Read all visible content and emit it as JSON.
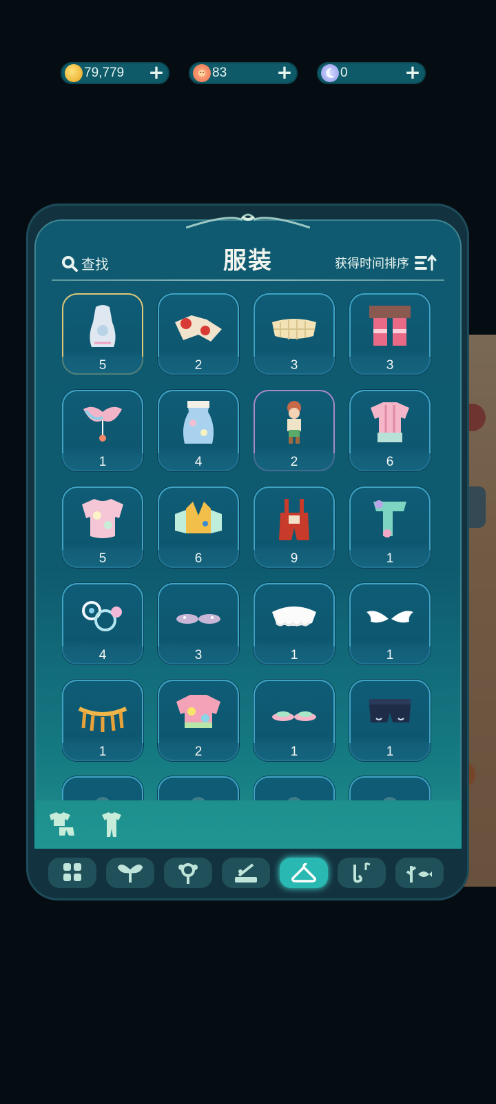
{
  "currencies": [
    {
      "name": "coin",
      "value": "79,779",
      "color": "#f4c23a"
    },
    {
      "name": "flower-token",
      "value": "83",
      "color": "#f3845c"
    },
    {
      "name": "moon-token",
      "value": "0",
      "color": "#9aa7f2"
    }
  ],
  "panel": {
    "title": "服装",
    "search_label": "查找",
    "sort_label": "获得时间排序"
  },
  "items": [
    {
      "icon": "lace-dress-icon",
      "count": "5",
      "rarity": "gold"
    },
    {
      "icon": "red-heart-sleeves-icon",
      "count": "2",
      "rarity": "normal"
    },
    {
      "icon": "waffle-skirt-icon",
      "count": "3",
      "rarity": "normal"
    },
    {
      "icon": "pink-stockings-icon",
      "count": "3",
      "rarity": "normal"
    },
    {
      "icon": "rainbow-collar-icon",
      "count": "1",
      "rarity": "normal"
    },
    {
      "icon": "blue-floral-dress-icon",
      "count": "4",
      "rarity": "normal"
    },
    {
      "icon": "character-outfit-icon",
      "count": "2",
      "rarity": "purple"
    },
    {
      "icon": "pink-shirt-shorts-icon",
      "count": "6",
      "rarity": "normal"
    },
    {
      "icon": "pink-floral-top-icon",
      "count": "5",
      "rarity": "normal"
    },
    {
      "icon": "yellow-overall-top-icon",
      "count": "6",
      "rarity": "normal"
    },
    {
      "icon": "red-overalls-icon",
      "count": "9",
      "rarity": "normal"
    },
    {
      "icon": "mint-leg-warmers-icon",
      "count": "1",
      "rarity": "normal"
    },
    {
      "icon": "flower-wheel-accessory-icon",
      "count": "4",
      "rarity": "normal"
    },
    {
      "icon": "sparkly-shoes-icon",
      "count": "3",
      "rarity": "normal"
    },
    {
      "icon": "lace-collar-icon",
      "count": "1",
      "rarity": "normal"
    },
    {
      "icon": "angel-wings-icon",
      "count": "1",
      "rarity": "normal"
    },
    {
      "icon": "gold-fringe-necklace-icon",
      "count": "1",
      "rarity": "normal"
    },
    {
      "icon": "polka-dot-top-icon",
      "count": "2",
      "rarity": "normal"
    },
    {
      "icon": "pastel-shoes-icon",
      "count": "1",
      "rarity": "normal"
    },
    {
      "icon": "navy-shorts-icon",
      "count": "1",
      "rarity": "normal"
    },
    {
      "icon": "partial-item-icon",
      "count": "",
      "rarity": "normal"
    },
    {
      "icon": "partial-item-icon",
      "count": "",
      "rarity": "normal"
    },
    {
      "icon": "partial-item-icon",
      "count": "",
      "rarity": "normal"
    },
    {
      "icon": "partial-item-icon",
      "count": "",
      "rarity": "normal"
    }
  ],
  "sub_tabs": [
    "top-bottom-icon",
    "full-outfit-icon"
  ],
  "nav": [
    {
      "icon": "grid-icon",
      "active": false
    },
    {
      "icon": "sprout-icon",
      "active": false
    },
    {
      "icon": "flower-icon",
      "active": false
    },
    {
      "icon": "furniture-icon",
      "active": false
    },
    {
      "icon": "hanger-icon",
      "active": true
    },
    {
      "icon": "music-icon",
      "active": false
    },
    {
      "icon": "fish-plant-icon",
      "active": false
    }
  ]
}
